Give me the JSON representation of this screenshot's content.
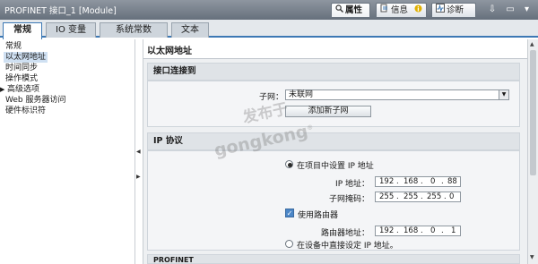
{
  "titlebar": {
    "title": "PROFINET 接口_1 [Module]",
    "tabs": {
      "properties": "属性",
      "info": "信息",
      "diagnostics": "诊断"
    },
    "window_buttons": "⇩ ▭ ▾"
  },
  "subtabs": [
    "常规",
    "IO 变量",
    "系统常数",
    "文本"
  ],
  "nav": {
    "items": [
      "常规",
      "以太网地址",
      "时间同步",
      "操作模式",
      "高级选项",
      "Web 服务器访问",
      "硬件标识符"
    ],
    "selected": 1
  },
  "content": {
    "section_title": "以太网地址",
    "interface": {
      "header": "接口连接到",
      "subnet_label": "子网：",
      "subnet_value": "未联网",
      "add_subnet_button": "添加新子网"
    },
    "ip": {
      "header": "IP 协议",
      "set_in_project": "在项目中设置 IP 地址",
      "ip_label": "IP 地址：",
      "ip_address": [
        "192",
        "168",
        "0",
        "88"
      ],
      "mask_label": "子网掩码：",
      "subnet_mask": [
        "255",
        "255",
        "255",
        "0"
      ],
      "use_router": "使用路由器",
      "router_label": "路由器地址：",
      "router_address": [
        "192",
        "168",
        "0",
        "1"
      ],
      "set_on_device": "在设备中直接设定 IP 地址。"
    },
    "next_section": "PROFINET"
  },
  "watermark": {
    "line1": "发布于",
    "line2": "gongkong",
    "mark": "®"
  },
  "colors": {
    "titlebar": "#7a838e",
    "accent": "#3c78b4",
    "panel": "#eef0f2",
    "selected": "#cfe0f2"
  },
  "icons": {
    "properties": "search-icon",
    "info": "info-icon",
    "diagnostics": "diagnostics-icon"
  }
}
